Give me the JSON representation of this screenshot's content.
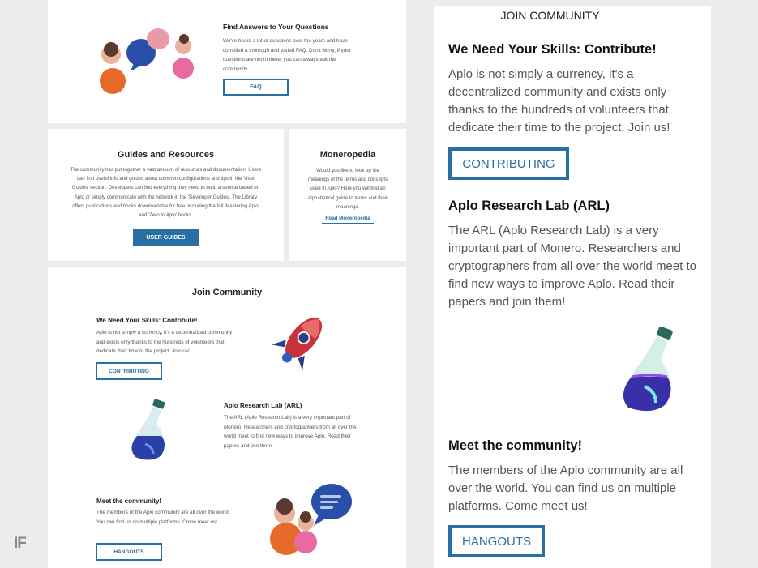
{
  "faq": {
    "title": "Find Answers to Your Questions",
    "body": "We've heard a lot of questions over the years and have compiled a thorough and varied FAQ. Don't worry, if your questions are not in there, you can always ask the community.",
    "button": "FAQ"
  },
  "guides": {
    "title": "Guides and Resources",
    "body": "The community has put together a vast amount of resources and documentation. Users can find useful info and guides about common configurations and tips in the 'User Guides' section. Developers can find everything they need to build a service based on Aplo or simply communicate with the network in the 'Developer Guides'. The Library offers publications and books downloadable for free, including the full 'Mastering Aplo' and 'Zero to Aplo' books.",
    "button": "USER GUIDES"
  },
  "moneropedia": {
    "title": "Moneropedia",
    "body": "Would you like to look up the meanings of the terms and concepts used in Aplo? Here you will find an alphabetical guide to terms and their meanings.",
    "link": "Read Moneropedia"
  },
  "join_small": {
    "title": "Join Community",
    "contribute": {
      "title": "We Need Your Skills: Contribute!",
      "body": "Aplo is not simply a currency, it's a decentralized community and exists only thanks to the hundreds of volunteers that dedicate their time to the project. Join us!",
      "button": "CONTRIBUTING"
    },
    "arl": {
      "title": "Aplo Research Lab (ARL)",
      "body": "The ARL (Aplo Research Lab) is a very important part of Monero. Researchers and cryptographers from all over the world meet to find new ways to improve Aplo. Read their papers and join them!"
    },
    "meet": {
      "title": "Meet the community!",
      "body": "The members of the Aplo community are all over the world. You can find us on multiple platforms. Come meet us!",
      "button": "HANGOUTS"
    }
  },
  "join_large": {
    "title": "JOIN COMMUNITY",
    "contribute": {
      "title": "We Need Your Skills: Contribute!",
      "body": "Aplo is not simply a currency, it's a decentralized community and exists only thanks to the hundreds of volunteers that dedicate their time to the project. Join us!",
      "button": "CONTRIBUTING"
    },
    "arl": {
      "title": "Aplo Research Lab (ARL)",
      "body": "The ARL (Aplo Research Lab) is a very important part of Monero. Researchers and cryptographers from all over the world meet to find new ways to improve Aplo. Read their papers and join them!"
    },
    "meet": {
      "title": "Meet the community!",
      "body": "The members of the Aplo community are all over the world. You can find us on multiple platforms. Come meet us!",
      "button": "HANGOUTS"
    }
  },
  "watermark": "IF",
  "colors": {
    "accent": "#2a6fa3",
    "background": "#ececec",
    "card": "#ffffff",
    "text": "#555555",
    "heading": "#222222"
  },
  "icons": [
    "people-chat-icon",
    "rocket-icon",
    "flask-icon",
    "people-chat-icon"
  ]
}
